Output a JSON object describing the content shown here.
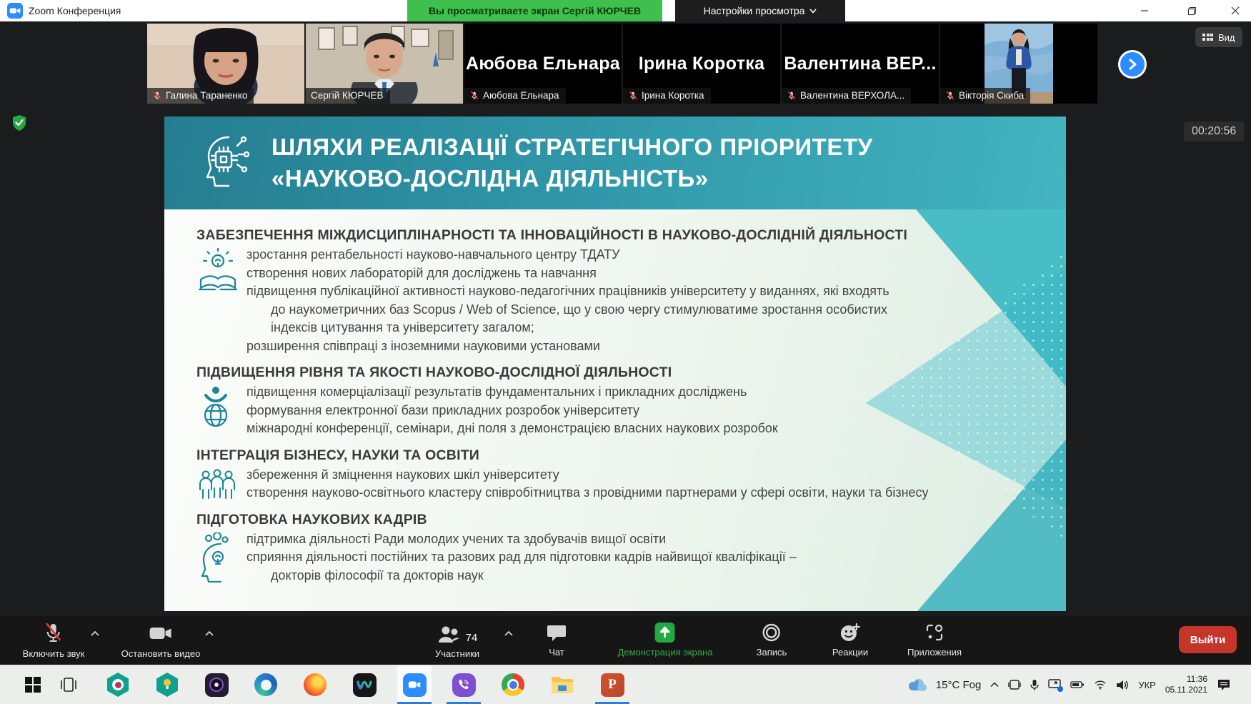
{
  "titlebar": {
    "app_title": "Zoom Конференция",
    "banner": "Вы просматриваете экран Сергій КЮРЧЕВ",
    "view_settings": "Настройки просмотра"
  },
  "video_strip": {
    "view_label": "Вид",
    "participants": [
      {
        "label": "Галина Тараненко",
        "muted": true
      },
      {
        "label": "Сергій КЮРЧЕВ",
        "muted": false,
        "active_speaker": true
      },
      {
        "display_name": "Аюбова Ельнара",
        "label": "Аюбова Ельнара",
        "muted": true
      },
      {
        "display_name": "Ірина Коротка",
        "label": "Ірина Коротка",
        "muted": true
      },
      {
        "display_name": "Валентина  ВЕР...",
        "label": "Валентина ВЕРХОЛА...",
        "muted": true
      },
      {
        "label": "Вікторія Скиба",
        "muted": true
      }
    ]
  },
  "share_timer": "00:20:56",
  "slide": {
    "title_line1": "ШЛЯХИ РЕАЛІЗАЦІЇ СТРАТЕГІЧНОГО ПРІОРИТЕТУ",
    "title_line2": "«НАУКОВО-ДОСЛІДНА ДІЯЛЬНІСТЬ»",
    "sections": [
      {
        "heading": "ЗАБЕЗПЕЧЕННЯ МІЖДИСЦИПЛІНАРНОСТІ ТА ІННОВАЦІЙНОСТІ В НАУКОВО-ДОСЛІДНІЙ ДІЯЛЬНОСТІ",
        "icon": "bulb-book-icon",
        "bullets": [
          {
            "text": "зростання рентабельності науково-навчального центру ТДАТУ",
            "indent": 0
          },
          {
            "text": "створення нових лабораторій для досліджень та навчання",
            "indent": 0
          },
          {
            "text": "підвищення публікаційної активності науково-педагогічних працівників університету у виданнях, які входять",
            "indent": 0
          },
          {
            "text": "до наукометричних баз Scopus / Web of Science, що у свою чергу стимулюватиме зростання особистих",
            "indent": 1
          },
          {
            "text": "індексів цитування та університету загалом;",
            "indent": 1
          },
          {
            "text": "розширення співпраці з іноземними науковими установами",
            "indent": 0
          }
        ]
      },
      {
        "heading": "ПІДВИЩЕННЯ РІВНЯ ТА ЯКОСТІ НАУКОВО-ДОСЛІДНОЇ ДІЯЛЬНОСТІ",
        "icon": "person-globe-icon",
        "bullets": [
          {
            "text": "підвищення комерціалізації результатів фундаментальних і прикладних досліджень",
            "indent": 0
          },
          {
            "text": "формування електронної бази прикладних розробок університету",
            "indent": 0
          },
          {
            "text": "міжнародні конференції, семінари, дні поля з демонстрацією власних наукових розробок",
            "indent": 0
          }
        ]
      },
      {
        "heading": "ІНТЕГРАЦІЯ БІЗНЕСУ, НАУКИ ТА ОСВІТИ",
        "icon": "people-group-icon",
        "bullets": [
          {
            "text": "збереження й зміцнення наукових шкіл університету",
            "indent": 0
          },
          {
            "text": "створення науково-освітнього кластеру співробітництва з провідними партнерами у сфері освіти, науки та бізнесу",
            "indent": 0
          }
        ]
      },
      {
        "heading": "ПІДГОТОВКА НАУКОВИХ КАДРІВ",
        "icon": "head-gears-icon",
        "bullets": [
          {
            "text": "підтримка діяльності Ради молодих учених та здобувачів вищої освіти",
            "indent": 0
          },
          {
            "text": "сприяння діяльності постійних та разових рад для підготовки кадрів найвищої кваліфікації –",
            "indent": 0
          },
          {
            "text": "докторів філософії та докторів наук",
            "indent": 1
          }
        ]
      }
    ]
  },
  "toolbar": {
    "mute_label": "Включить звук",
    "video_label": "Остановить видео",
    "participants_label": "Участники",
    "participants_count": "74",
    "chat_label": "Чат",
    "share_label": "Демонстрация экрана",
    "record_label": "Запись",
    "reactions_label": "Реакции",
    "apps_label": "Приложения",
    "leave_label": "Выйти"
  },
  "taskbar": {
    "weather": "15°C Fog",
    "language": "УКР",
    "time": "11:36",
    "date": "05.11.2021"
  },
  "colors": {
    "share_banner_green": "#3fbf4d",
    "active_speaker_border": "#b4d334",
    "slide_teal": "#2f96a8",
    "share_button_green": "#23a843",
    "leave_red": "#c6352a",
    "taskbar_accent": "#2e7bd6"
  }
}
